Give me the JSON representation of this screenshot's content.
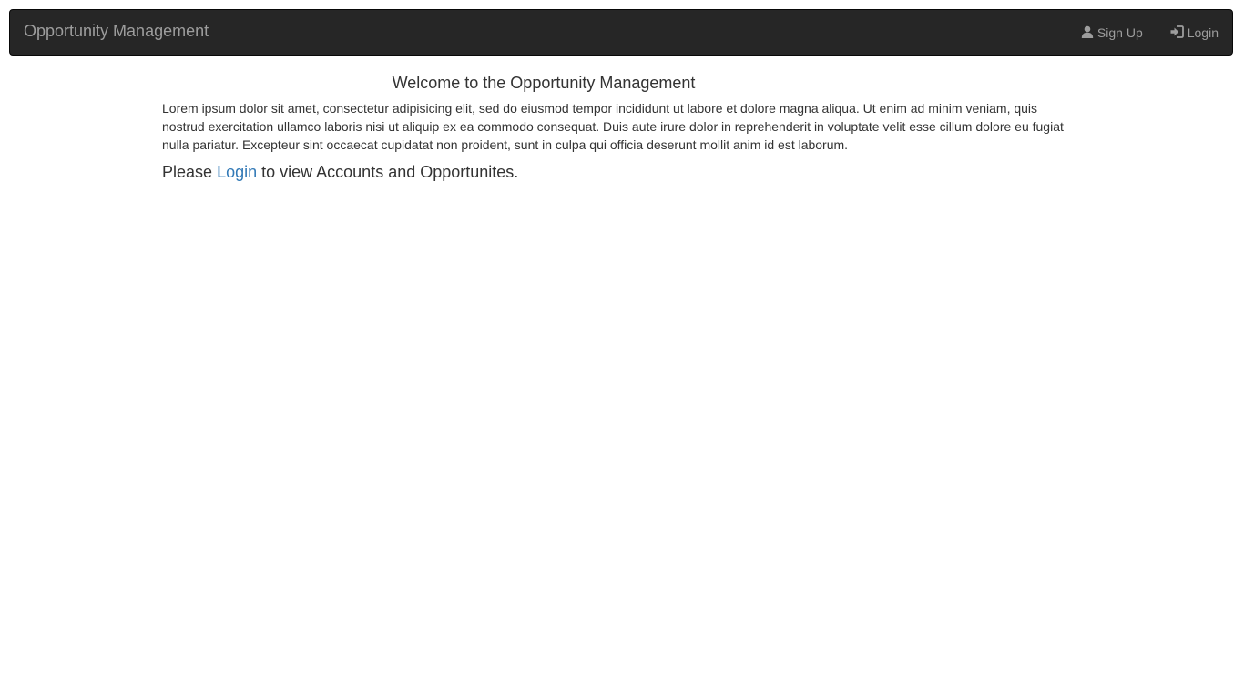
{
  "navbar": {
    "brand": "Opportunity Management",
    "links": [
      {
        "label": "Sign Up",
        "icon": "user-icon"
      },
      {
        "label": "Login",
        "icon": "log-in-icon"
      }
    ]
  },
  "main": {
    "title": "Welcome to the Opportunity Management",
    "paragraph": "Lorem ipsum dolor sit amet, consectetur adipisicing elit, sed do eiusmod tempor incididunt ut labore et dolore magna aliqua. Ut enim ad minim veniam, quis nostrud exercitation ullamco laboris nisi ut aliquip ex ea commodo consequat. Duis aute irure dolor in reprehenderit in voluptate velit esse cillum dolore eu fugiat nulla pariatur. Excepteur sint occaecat cupidatat non proident, sunt in culpa qui officia deserunt mollit anim id est laborum.",
    "cta": {
      "prefix": "Please",
      "link": "Login",
      "suffix": "to view Accounts and Opportunites."
    }
  },
  "colors": {
    "navbar_bg": "#262626",
    "navbar_text": "#9d9d9d",
    "link": "#337ab7",
    "body_text": "#333333"
  }
}
